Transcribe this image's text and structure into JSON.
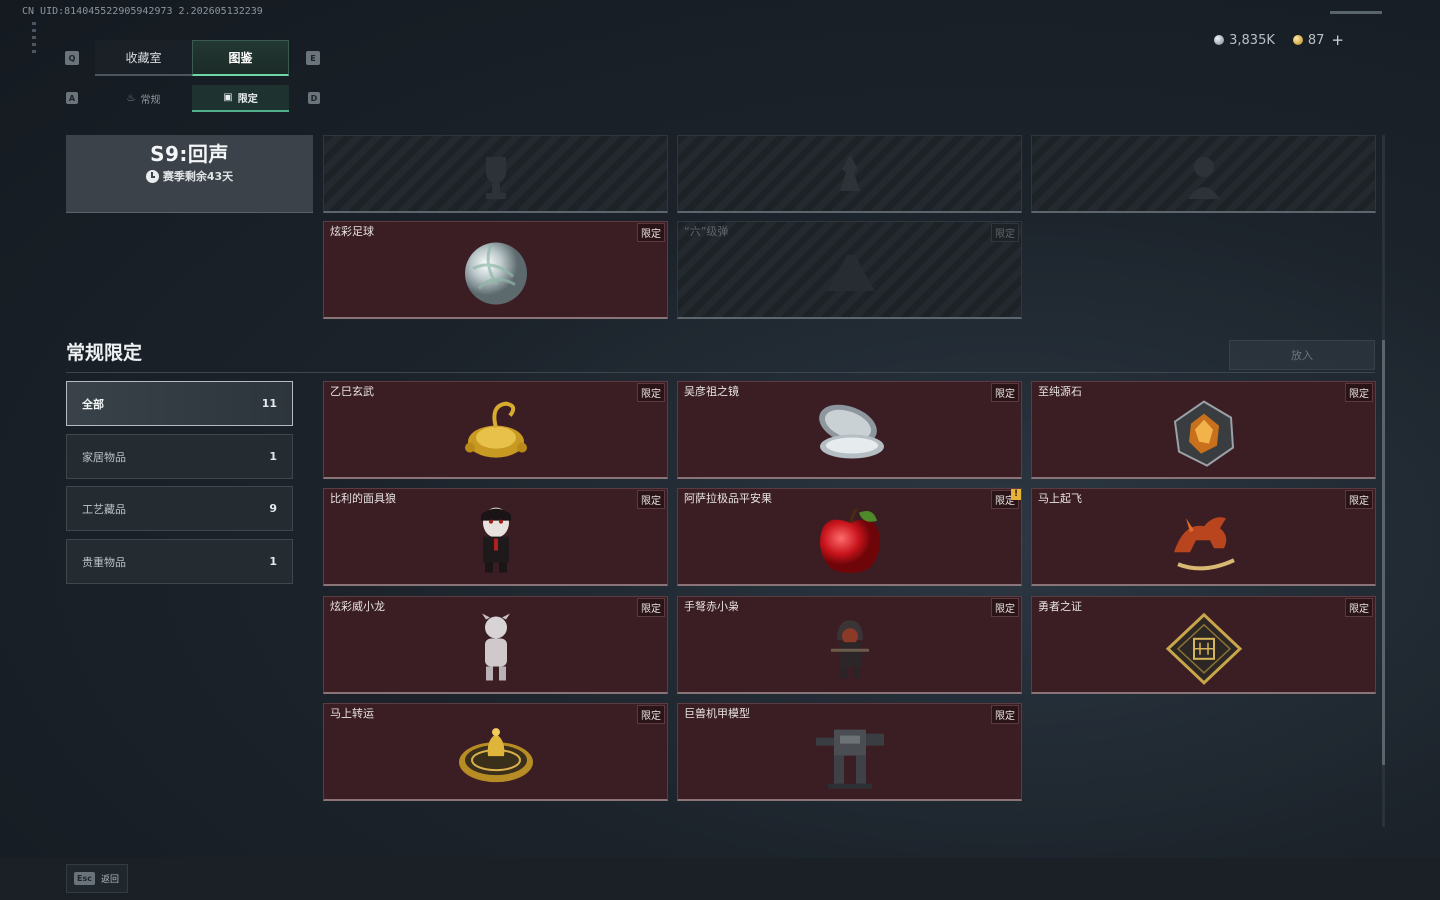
{
  "uid": "CN UID:814045522905942973 2.202605132239",
  "currency": {
    "silver": "3,835K",
    "gold": "87",
    "plus": "+"
  },
  "keys": {
    "q": "Q",
    "e": "E",
    "a": "A",
    "d": "D"
  },
  "main_tabs": [
    {
      "label": "收藏室",
      "active": false
    },
    {
      "label": "图鉴",
      "active": true
    }
  ],
  "sub_tabs": [
    {
      "label": "常规",
      "icon": "flame-icon"
    },
    {
      "label": "限定",
      "icon": "box-icon"
    }
  ],
  "season": {
    "title": "S9:回声",
    "remaining": "赛季剩余43天"
  },
  "season_cards": [
    {
      "name": "炫彩足球",
      "tag": "限定",
      "locked": false
    },
    {
      "name": "“六”级弹",
      "tag": "限定",
      "locked": true
    }
  ],
  "section": {
    "title": "常规限定",
    "put_in": "放入"
  },
  "filters": [
    {
      "label": "全部",
      "count": "11",
      "active": true
    },
    {
      "label": "家居物品",
      "count": "1",
      "active": false
    },
    {
      "label": "工艺藏品",
      "count": "9",
      "active": false
    },
    {
      "label": "贵重物品",
      "count": "1",
      "active": false
    }
  ],
  "items": [
    {
      "name": "乙巳玄武",
      "tag": "限定"
    },
    {
      "name": "吴彦祖之镜",
      "tag": "限定"
    },
    {
      "name": "至纯源石",
      "tag": "限定"
    },
    {
      "name": "比利的面具狼",
      "tag": "限定"
    },
    {
      "name": "阿萨拉极品平安果",
      "tag": "限定",
      "alert": "!"
    },
    {
      "name": "马上起飞",
      "tag": "限定"
    },
    {
      "name": "炫彩威小龙",
      "tag": "限定"
    },
    {
      "name": "手弩赤小枭",
      "tag": "限定"
    },
    {
      "name": "勇者之证",
      "tag": "限定"
    },
    {
      "name": "马上转运",
      "tag": "限定"
    },
    {
      "name": "巨兽机甲模型",
      "tag": "限定"
    }
  ],
  "bottom": {
    "esc_key": "Esc",
    "back": "返回"
  }
}
